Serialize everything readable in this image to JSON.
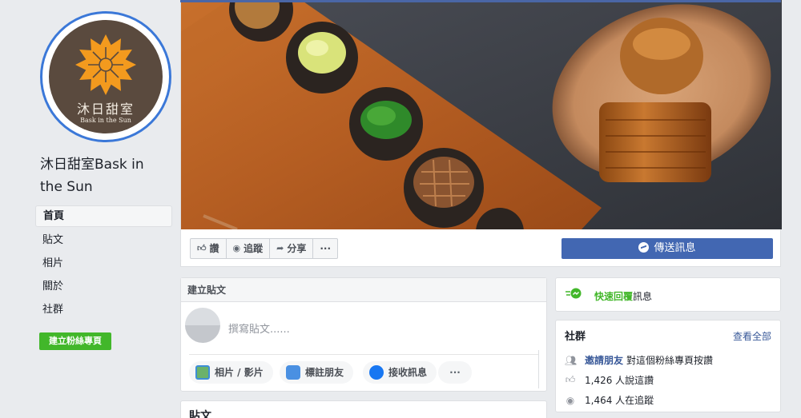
{
  "page": {
    "name": "沐日甜室Bask in the Sun",
    "logo_cn": "沐日甜室",
    "logo_en": "Bask in the Sun"
  },
  "nav": [
    {
      "label": "首頁",
      "active": true
    },
    {
      "label": "貼文"
    },
    {
      "label": "相片"
    },
    {
      "label": "關於"
    },
    {
      "label": "社群"
    }
  ],
  "create_page_label": "建立粉絲專頁",
  "actions": {
    "like": "讚",
    "follow": "追蹤",
    "share": "分享",
    "more": "···",
    "send_message": "傳送訊息"
  },
  "composer": {
    "title": "建立貼文",
    "placeholder": "撰寫貼文......",
    "photo": "相片 / 影片",
    "tag": "標註朋友",
    "message": "接收訊息",
    "more": "···"
  },
  "posts_title": "貼文",
  "quick_reply": {
    "highlight": "快速回覆",
    "rest": "訊息"
  },
  "community": {
    "title": "社群",
    "see_all": "查看全部",
    "invite_link": "邀請朋友",
    "invite_rest": "對這個粉絲專頁按讚",
    "likes": "1,426 人說這讚",
    "follows": "1,464 人在追蹤"
  },
  "colors": {
    "brand_blue": "#4267b2",
    "create_green": "#42b72a",
    "link": "#385898",
    "logo_orange": "#f39a1e",
    "logo_brown": "#5a4a3e"
  },
  "icons": [
    "thumbs-up-icon",
    "rss-icon",
    "share-icon",
    "messenger-icon",
    "photo-icon",
    "tag-friend-icon",
    "quick-reply-icon",
    "people-icon"
  ]
}
